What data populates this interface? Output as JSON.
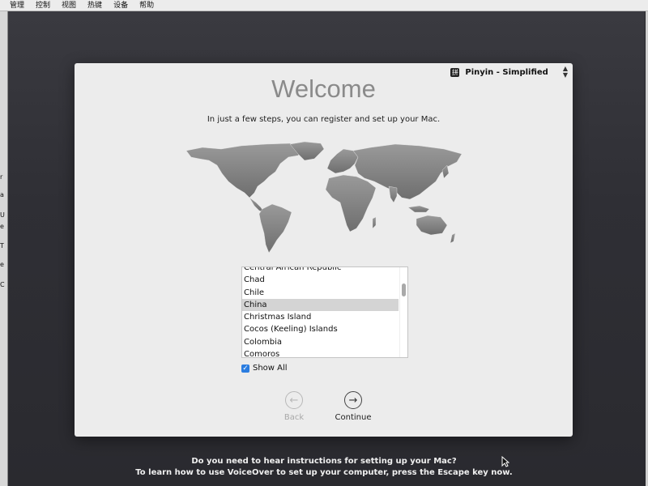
{
  "menubar": {
    "items": [
      "管理",
      "控制",
      "视图",
      "热键",
      "设备",
      "帮助"
    ]
  },
  "left_strip": {
    "marks": [
      "r",
      "a",
      "U",
      "e",
      "T",
      "e",
      "C"
    ]
  },
  "input_source": {
    "icon": "拼",
    "label": "Pinyin - Simplified"
  },
  "welcome": {
    "title": "Welcome",
    "subtitle": "In just a few steps, you can register and set up your Mac."
  },
  "country_list": {
    "items": [
      "Central African Republic",
      "Chad",
      "Chile",
      "China",
      "Christmas Island",
      "Cocos (Keeling) Islands",
      "Colombia",
      "Comoros"
    ],
    "selected": "China"
  },
  "show_all": {
    "label": "Show All",
    "checked": true
  },
  "navigation": {
    "back_label": "Back",
    "continue_label": "Continue"
  },
  "footer": {
    "line1": "Do you need to hear instructions for setting up your Mac?",
    "line2": "To learn how to use VoiceOver to set up your computer, press the Escape key now."
  },
  "colors": {
    "accent": "#2b7de0",
    "panel_bg": "#ececec",
    "screen_bg": "#2f2f35",
    "selection": "#d4d4d4"
  }
}
